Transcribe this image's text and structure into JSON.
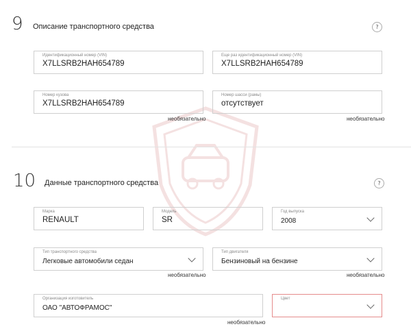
{
  "section9": {
    "number": "9",
    "title": "Описание транспортного средства",
    "help": "?",
    "fields": [
      {
        "label": "Идентификационный номер (VIN)",
        "value": "X7LLSRB2HAH654789"
      },
      {
        "label": "Еще раз идентификационный номер (VIN)",
        "value": "X7LLSRB2HAH654789"
      },
      {
        "label": "Номер кузова",
        "value": "X7LLSRB2HAH654789",
        "note": "необязательно"
      },
      {
        "label": "Номер шасси (рамы)",
        "value": "отсутствует",
        "note": "необязательно"
      }
    ]
  },
  "section10": {
    "number": "10",
    "title": "Данные транспортного средства",
    "help": "?",
    "brand": {
      "label": "Марка",
      "value": "RENAULT"
    },
    "model": {
      "label": "Модель",
      "value": "SR"
    },
    "year": {
      "label": "Год выпуска",
      "value": "2008"
    },
    "vehicle_type": {
      "label": "Тип транспортного средства",
      "value": "Легковые автомобили седан",
      "note": "необязательно"
    },
    "engine_type": {
      "label": "Тип двигателя",
      "value": "Бензиновый на бензине",
      "note": "необязательно"
    },
    "manufacturer": {
      "label": "Организация изготовитель",
      "value": "ОАО \"АВТОФРАМОС\"",
      "note": "необязательно"
    },
    "color": {
      "label": "Цвет",
      "value": ""
    }
  },
  "colors": {
    "error_border": "#e58b8b",
    "watermark": "#b22222"
  },
  "icons": {
    "help": "question-circle-icon",
    "dropdown": "chevron-down-icon",
    "watermark": "shield-car-watermark"
  }
}
